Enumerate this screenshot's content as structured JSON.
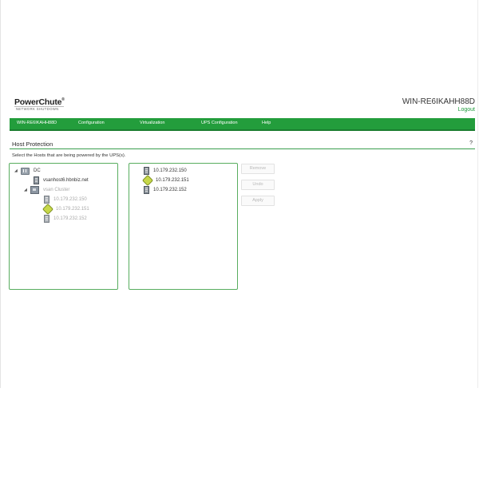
{
  "header": {
    "logo_title": "PowerChute",
    "logo_trademark": "®",
    "logo_subtitle": "NETWORK SHUTDOWN",
    "host_name": "WIN-RE6IKAHH88D",
    "logout": "Logout"
  },
  "nav": {
    "items": [
      "WIN-RE6IKAHH88D",
      "Configuration",
      "Virtualization",
      "UPS Configuration",
      "Help"
    ]
  },
  "page": {
    "title": "Host Protection",
    "help": "?",
    "instructions": "Select the Hosts that are being powered by the UPS(s)."
  },
  "tree": {
    "root": {
      "label": "DC",
      "icon": "datacenter-icon",
      "arrow": "◢"
    },
    "host": {
      "label": "vsanhost6.hbnbiz.net",
      "icon": "server-icon"
    },
    "cluster": {
      "label": "vsan Cluster",
      "icon": "cluster-icon",
      "arrow": "◢"
    },
    "cluster_hosts": [
      {
        "label": "10.179.232.150",
        "icon": "server-icon"
      },
      {
        "label": "10.179.232.151",
        "icon": "vm-leaf-icon"
      },
      {
        "label": "10.179.232.152",
        "icon": "server-icon"
      }
    ]
  },
  "selected_hosts": [
    {
      "label": "10.179.232.150",
      "icon": "server-icon"
    },
    {
      "label": "10.179.232.151",
      "icon": "vm-leaf-icon"
    },
    {
      "label": "10.179.232.152",
      "icon": "server-icon"
    }
  ],
  "buttons": {
    "remove": "Remove",
    "undo": "Undo",
    "apply": "Apply"
  },
  "colors": {
    "nav_green": "#239d3c",
    "accent_green": "#1e9a3c",
    "disabled_text": "#a8a8a8"
  }
}
